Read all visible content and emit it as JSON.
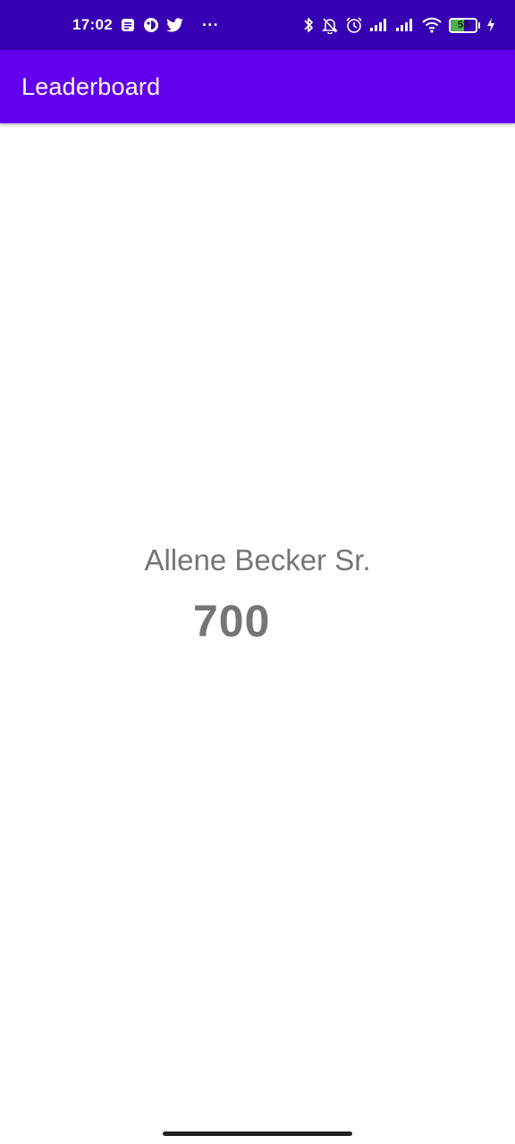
{
  "status_bar": {
    "time": "17:02",
    "more": "···",
    "battery_level": "53",
    "battery_fraction": 0.53,
    "icons_left": [
      "notes-icon",
      "app-circle-icon",
      "twitter-bird-icon"
    ],
    "icons_right": [
      "bluetooth-icon",
      "bell-off-icon",
      "alarm-icon",
      "signal-icon",
      "signal-icon",
      "wifi-icon",
      "battery-icon",
      "charging-icon"
    ]
  },
  "app_bar": {
    "title": "Leaderboard",
    "color": "#6200ee"
  },
  "leaderboard": {
    "player_name": "Allene Becker Sr.",
    "score": "700"
  },
  "colors": {
    "status_bar": "#3700b3",
    "app_bar": "#6200ee",
    "text_secondary": "#757575"
  }
}
